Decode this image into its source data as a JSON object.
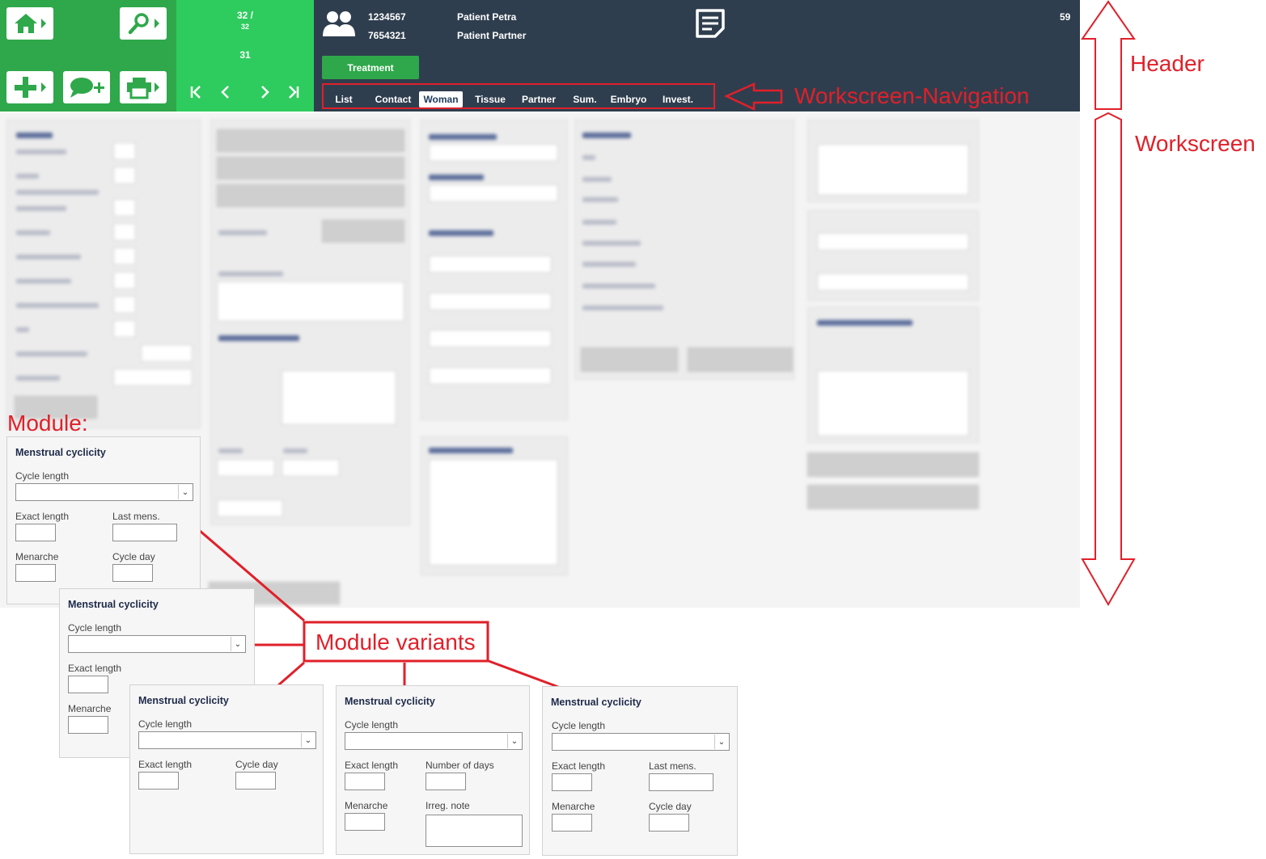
{
  "pager": {
    "count_top": "32 /",
    "count_small": "32",
    "count_mid": "31"
  },
  "header": {
    "id_1": "1234567",
    "id_2": "7654321",
    "patient_1": "Patient Petra",
    "patient_2": "Patient Partner",
    "number": "59",
    "treatment_label": "Treatment"
  },
  "nav": {
    "items": [
      {
        "label": "List"
      },
      {
        "label": "Contact"
      },
      {
        "label": "Woman"
      },
      {
        "label": "Tissue"
      },
      {
        "label": "Partner"
      },
      {
        "label": "Sum."
      },
      {
        "label": "Embryo"
      },
      {
        "label": "Invest."
      }
    ],
    "active": "Woman"
  },
  "annotations": {
    "header": "Header",
    "workscreen_navigation": "Workscreen-Navigation",
    "workscreen": "Workscreen",
    "module": "Module:",
    "module_variants": "Module variants"
  },
  "module": {
    "title": "Menstrual cyclicity",
    "cycle_length": "Cycle length",
    "exact_length": "Exact length",
    "last_mens": "Last mens.",
    "menarche": "Menarche",
    "cycle_day": "Cycle day",
    "number_of_days": "Number of days",
    "irreg_note": "Irreg. note"
  },
  "colors": {
    "green_dark": "#2ea84a",
    "green_light": "#2ecc5e",
    "header_bg": "#2f3e4e",
    "annotation_red": "#e0202a"
  },
  "icons": [
    "home-icon",
    "search-icon",
    "add-icon",
    "chat-add-icon",
    "print-icon",
    "patients-icon",
    "notes-icon",
    "first-page-icon",
    "prev-page-icon",
    "next-page-icon",
    "last-page-icon"
  ]
}
